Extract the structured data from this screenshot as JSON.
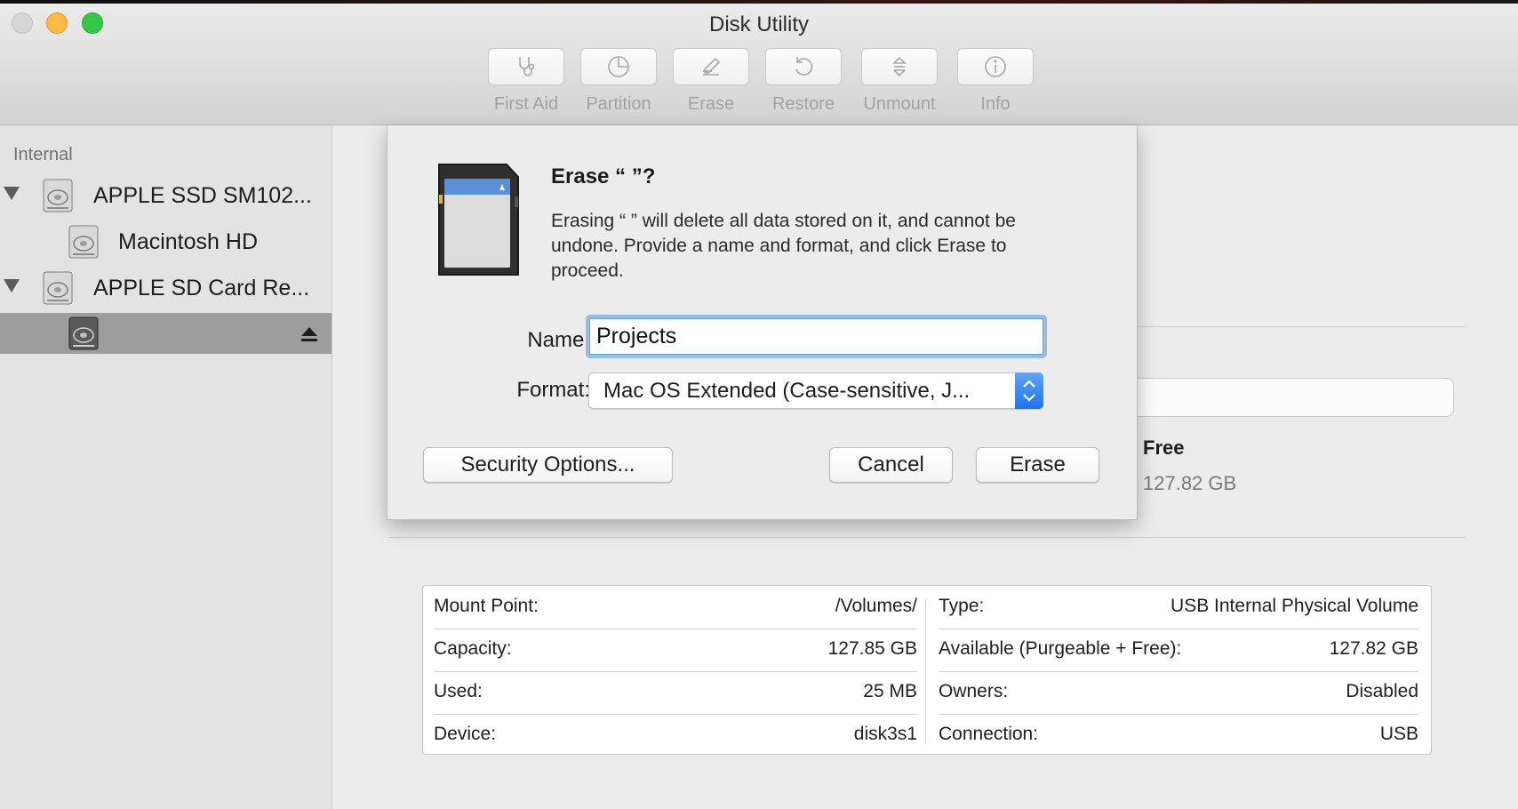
{
  "window": {
    "title": "Disk Utility"
  },
  "toolbar": {
    "items": [
      {
        "label": "First Aid",
        "icon": "stethoscope-icon"
      },
      {
        "label": "Partition",
        "icon": "pie-chart-icon"
      },
      {
        "label": "Erase",
        "icon": "erase-pencil-icon"
      },
      {
        "label": "Restore",
        "icon": "restore-arrow-icon"
      },
      {
        "label": "Unmount",
        "icon": "unmount-icon"
      },
      {
        "label": "Info",
        "icon": "info-icon"
      }
    ]
  },
  "sidebar": {
    "heading": "Internal",
    "items": [
      {
        "label": "APPLE SSD SM102...",
        "level": 0,
        "disclosure": true,
        "selected": false
      },
      {
        "label": "Macintosh HD",
        "level": 1,
        "disclosure": false,
        "selected": false
      },
      {
        "label": "APPLE SD Card Re...",
        "level": 0,
        "disclosure": true,
        "selected": false
      },
      {
        "label": "",
        "level": 1,
        "disclosure": false,
        "selected": true,
        "eject": true
      }
    ]
  },
  "usage": {
    "free_title": "Free",
    "free_value": "127.82 GB"
  },
  "info": {
    "left": [
      {
        "key": "Mount Point:",
        "value": "/Volumes/"
      },
      {
        "key": "Capacity:",
        "value": "127.85 GB"
      },
      {
        "key": "Used:",
        "value": "25 MB"
      },
      {
        "key": "Device:",
        "value": "disk3s1"
      }
    ],
    "right": [
      {
        "key": "Type:",
        "value": "USB Internal Physical Volume"
      },
      {
        "key": "Available (Purgeable + Free):",
        "value": "127.82 GB"
      },
      {
        "key": "Owners:",
        "value": "Disabled"
      },
      {
        "key": "Connection:",
        "value": "USB"
      }
    ]
  },
  "dialog": {
    "title": "Erase “ ”?",
    "message": "Erasing “ ” will delete all data stored on it, and cannot be undone. Provide a name and format, and click Erase to proceed.",
    "name_label": "Name:",
    "name_value": "Projects",
    "format_label": "Format:",
    "format_value": "Mac OS Extended (Case-sensitive, J...",
    "security_button": "Security Options...",
    "cancel_button": "Cancel",
    "erase_button": "Erase"
  },
  "colors": {
    "accent": "#1c74f4",
    "focus_ring": "#94bde7",
    "selection": "#9d9d9d",
    "close": "#d7d7d7",
    "minimize": "#fdbc40",
    "zoom": "#33c748"
  }
}
